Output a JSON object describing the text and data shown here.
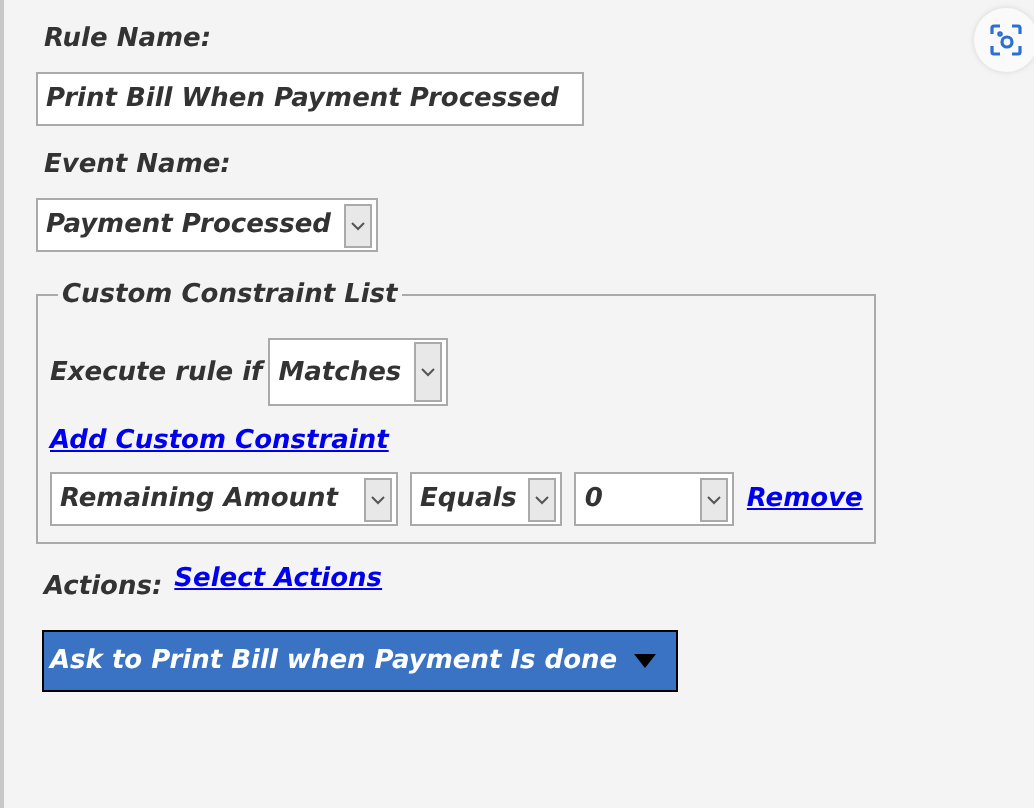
{
  "rule_name": {
    "label": "Rule Name:",
    "value": "Print Bill When Payment Processed"
  },
  "event_name": {
    "label": "Event Name:",
    "value": "Payment Processed"
  },
  "constraints": {
    "legend": "Custom Constraint List",
    "execute_label": "Execute rule if",
    "execute_value": "Matches",
    "add_link": "Add Custom Constraint",
    "rows": [
      {
        "field": "Remaining Amount",
        "operator": "Equals",
        "value": "0",
        "remove": "Remove"
      }
    ]
  },
  "actions": {
    "label": "Actions:",
    "link": "Select Actions",
    "selected_action": "Ask to Print Bill when Payment Is done"
  }
}
